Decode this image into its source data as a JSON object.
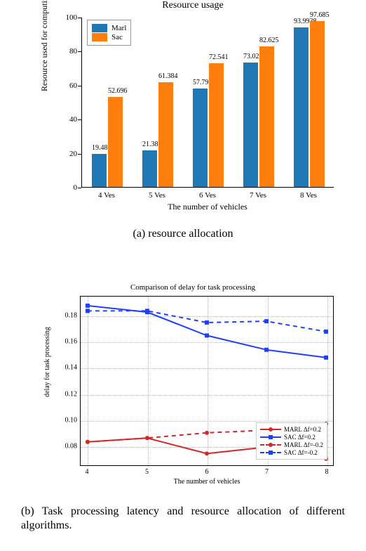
{
  "chart_data": [
    {
      "id": "resource_usage_bar",
      "type": "bar",
      "title": "Resource usage",
      "xlabel": "The number of vehicles",
      "ylabel": "Resource used for computing tasks",
      "categories": [
        "4 Ves",
        "5 Ves",
        "6 Ves",
        "7 Ves",
        "8 Ves"
      ],
      "series": [
        {
          "name": "Marl",
          "color": "#1f77b4",
          "values": [
            19.4815,
            21.385,
            57.7939,
            73.0239,
            93.9938
          ]
        },
        {
          "name": "Sac",
          "color": "#ff7f0e",
          "values": [
            52.696,
            61.384,
            72.541,
            82.625,
            97.685
          ]
        }
      ],
      "yticks": [
        0,
        20,
        40,
        60,
        80,
        100
      ],
      "ylim": [
        0,
        100
      ]
    },
    {
      "id": "delay_line",
      "type": "line",
      "title": "Comparison of delay for task processing",
      "xlabel": "The number of vehicles",
      "ylabel": "delay for task processing",
      "x": [
        4,
        5,
        6,
        7,
        8
      ],
      "yticks": [
        0.08,
        0.1,
        0.12,
        0.14,
        0.16,
        0.18
      ],
      "ylim": [
        0.065,
        0.195
      ],
      "series": [
        {
          "name": "MARL Δf=0.2",
          "color": "#d62728",
          "dash": false,
          "marker": "circle",
          "values": [
            0.083,
            0.086,
            0.074,
            0.079,
            0.07
          ]
        },
        {
          "name": "SAC Δf=0.2",
          "color": "#1f3fff",
          "dash": false,
          "marker": "square",
          "values": [
            0.188,
            0.183,
            0.165,
            0.154,
            0.148
          ]
        },
        {
          "name": "MARL Δf=-0.2",
          "color": "#d62728",
          "dash": true,
          "marker": "circle",
          "values": [
            0.083,
            0.086,
            0.09,
            0.092,
            0.097
          ]
        },
        {
          "name": "SAC Δf=-0.2",
          "color": "#1f3fff",
          "dash": true,
          "marker": "square",
          "values": [
            0.184,
            0.184,
            0.175,
            0.176,
            0.168
          ]
        }
      ]
    }
  ],
  "captions": {
    "a": "(a)  resource allocation",
    "b": "(b) Task processing latency and resource allocation of different algorithms."
  }
}
